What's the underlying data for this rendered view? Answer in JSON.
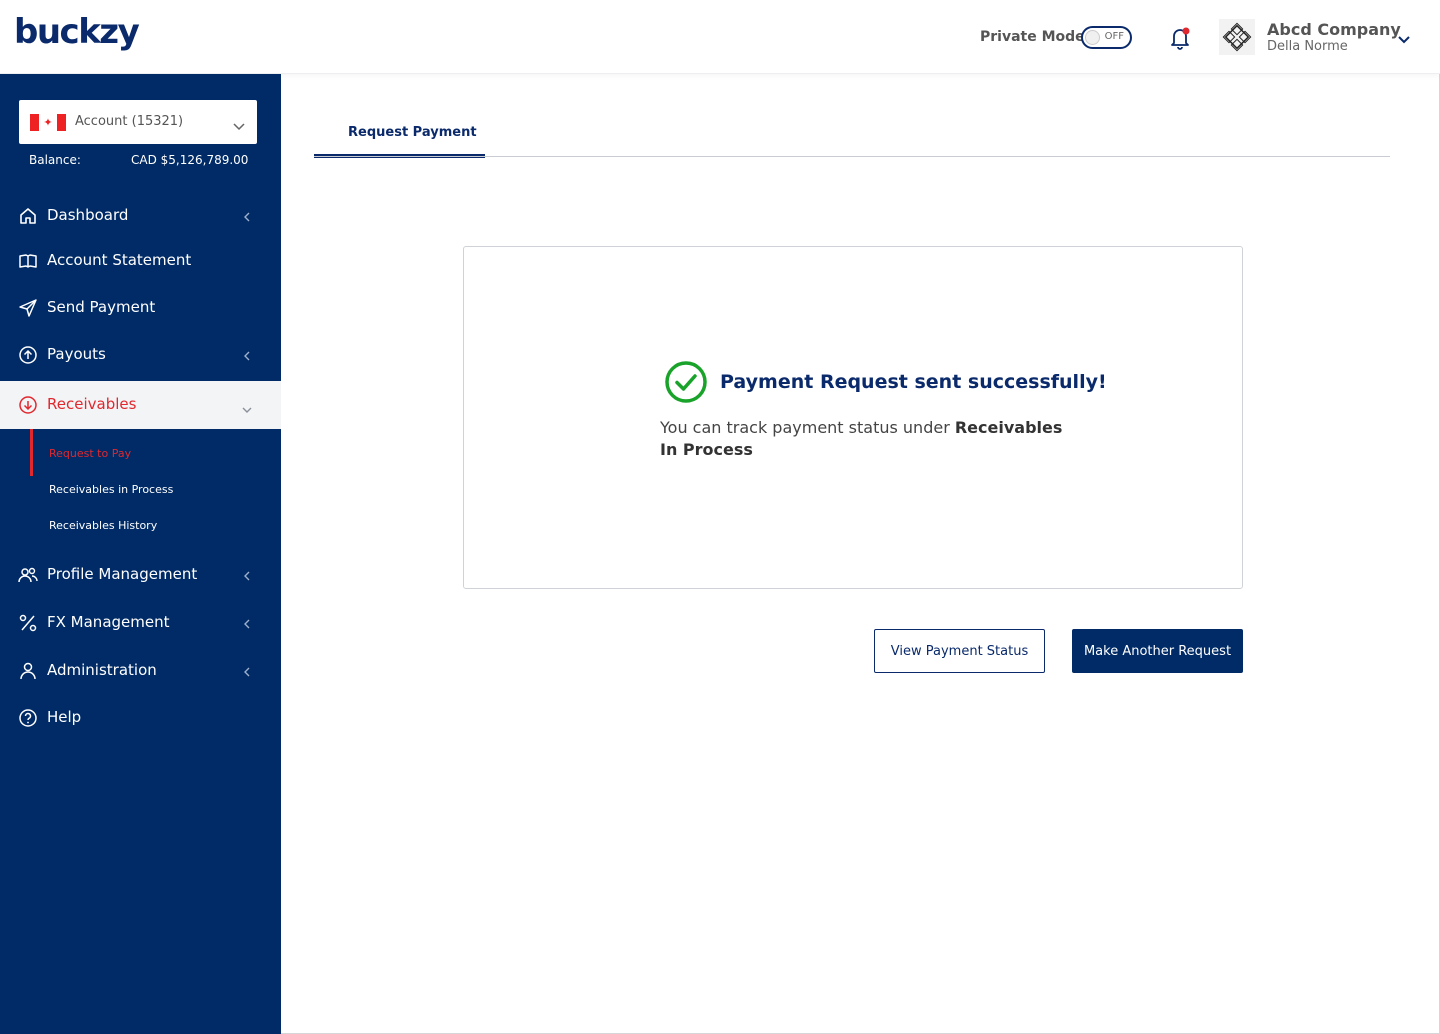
{
  "brand": {
    "logo_text": "buckzy"
  },
  "header": {
    "private_mode_label": "Private Mode",
    "private_mode_state": "OFF",
    "company_name": "Abcd Company",
    "user_name": "Della Norme"
  },
  "sidebar": {
    "account_label": "Account (15321)",
    "balance_label": "Balance:",
    "balance_value": "CAD $5,126,789.00",
    "items": [
      {
        "label": "Dashboard"
      },
      {
        "label": "Account Statement"
      },
      {
        "label": "Send Payment"
      },
      {
        "label": "Payouts"
      },
      {
        "label": "Receivables"
      },
      {
        "label": "Profile Management"
      },
      {
        "label": "FX Management"
      },
      {
        "label": "Administration"
      },
      {
        "label": "Help"
      }
    ],
    "receivables_sub": [
      {
        "label": "Request to Pay"
      },
      {
        "label": "Receivables in Process"
      },
      {
        "label": "Receivables History"
      }
    ]
  },
  "main": {
    "tab_label": "Request Payment",
    "success_title": "Payment Request sent successfully!",
    "track_prefix": "You can track payment status under ",
    "track_link": "Receivables In Process",
    "view_status_button": "View Payment Status",
    "another_request_button": "Make Another Request"
  },
  "colors": {
    "navy": "#002b66",
    "accent_red": "#e0282e",
    "success_green": "#1aa32a"
  }
}
